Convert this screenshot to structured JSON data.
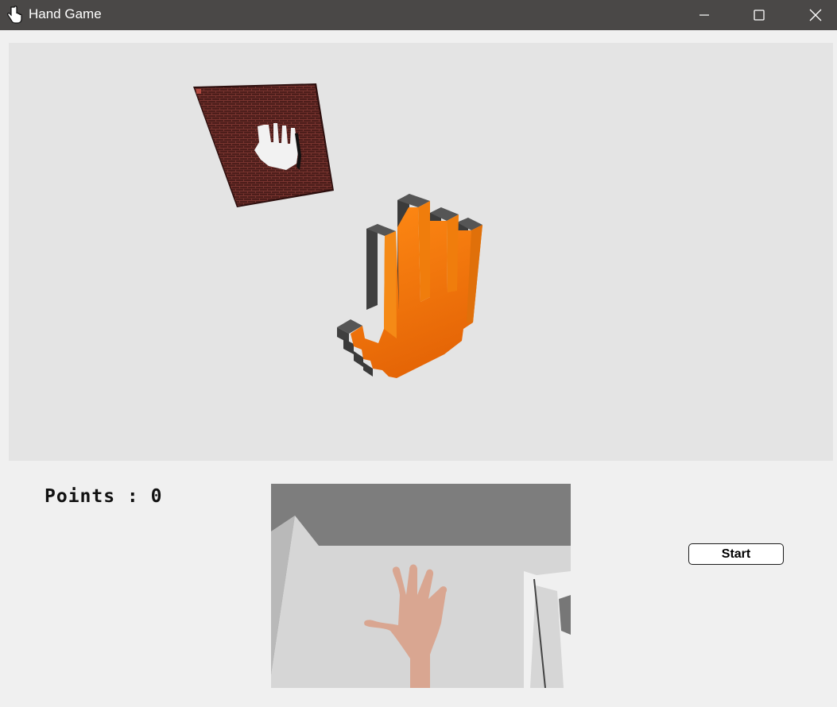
{
  "window": {
    "title": "Hand Game",
    "app_icon": "pointing-hand-icon",
    "controls": {
      "minimize_icon": "minimize-icon",
      "maximize_icon": "maximize-icon",
      "close_icon": "close-icon"
    }
  },
  "game_view": {
    "wall_icon": "brick-wall-with-hand-hole",
    "hand_icon": "orange-voxel-hand",
    "colors": {
      "background": "#e4e4e4",
      "hand": "#f07d0c",
      "hand_side": "#464646",
      "wall": "#4a1f1c"
    }
  },
  "score": {
    "text": "Points : 0"
  },
  "camera": {
    "content": "webcam-feed-raised-hand"
  },
  "controls": {
    "start_label": "Start"
  }
}
